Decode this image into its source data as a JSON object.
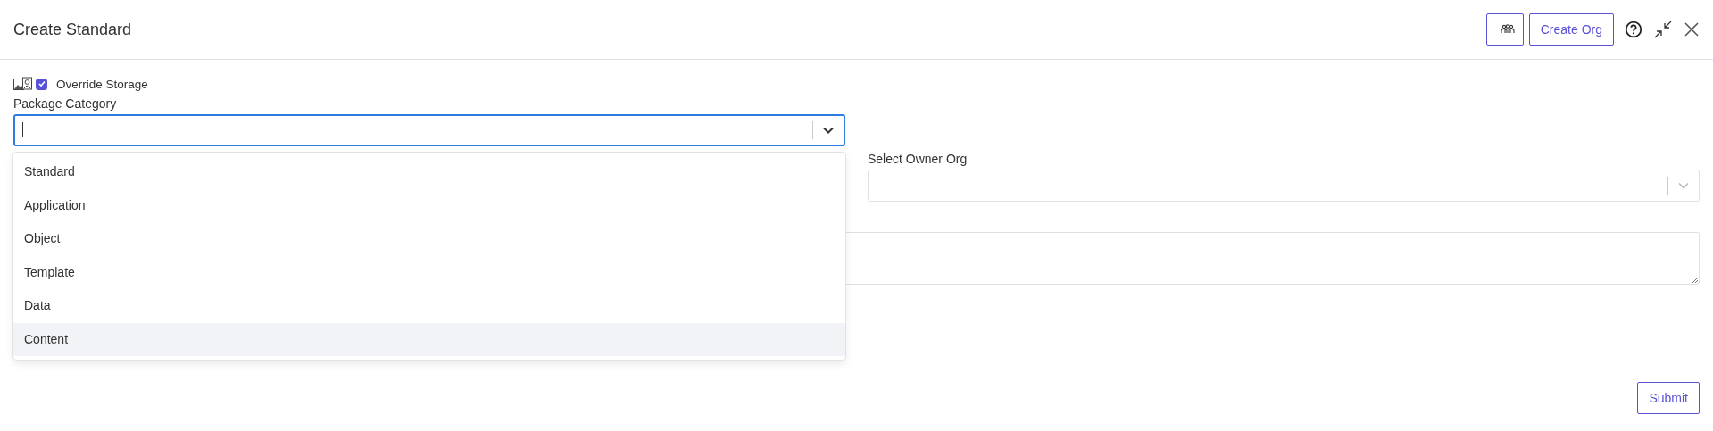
{
  "dialog": {
    "title": "Create Standard",
    "create_org_button": "Create Org"
  },
  "override_storage": {
    "label": "Override Storage",
    "checked": true
  },
  "package_category": {
    "label": "Package Category",
    "expanded": true,
    "options": [
      {
        "label": "Standard",
        "highlighted": false
      },
      {
        "label": "Application",
        "highlighted": false
      },
      {
        "label": "Object",
        "highlighted": false
      },
      {
        "label": "Template",
        "highlighted": false
      },
      {
        "label": "Data",
        "highlighted": false
      },
      {
        "label": "Content",
        "highlighted": true
      }
    ]
  },
  "owner_org": {
    "label": "Select Owner Org"
  },
  "submit_button": "Submit"
}
